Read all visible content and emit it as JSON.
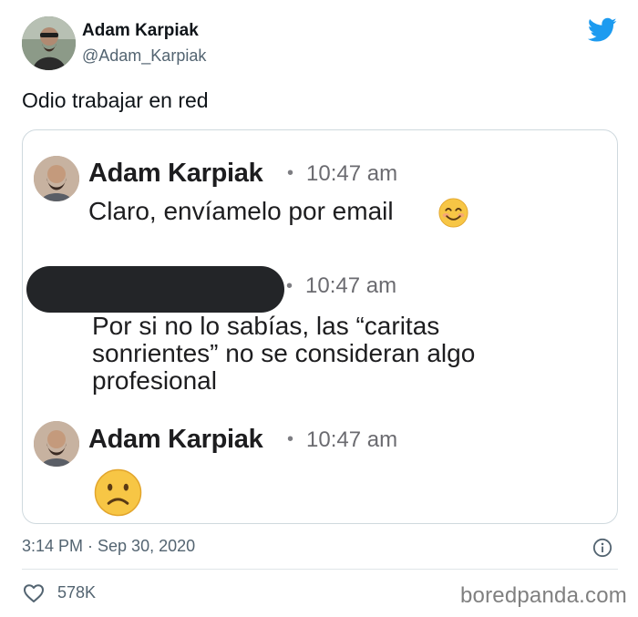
{
  "author": {
    "name": "Adam Karpiak",
    "handle": "@Adam_Karpiak"
  },
  "tweet": {
    "text": "Odio trabajar en red",
    "timestamp": "3:14 PM · Sep 30, 2020",
    "likes": "578K"
  },
  "messages": [
    {
      "sender": "Adam Karpiak",
      "dot": "•",
      "time": "10:47 am",
      "text": "Claro, envíamelo por email",
      "emoji": "smiling-face-icon"
    },
    {
      "sender": "",
      "dot": "•",
      "time": "10:47 am",
      "text_lines": [
        "Por si no lo sabías, las “caritas",
        "sonrientes” no se consideran algo",
        "profesional"
      ]
    },
    {
      "sender": "Adam Karpiak",
      "dot": "•",
      "time": "10:47 am",
      "emoji": "frowning-face-icon"
    }
  ],
  "watermark": "boredpanda.com",
  "colors": {
    "twitter_blue": "#1d9bf0",
    "emoji_yellow": "#f7c645",
    "muted_text": "#536471",
    "redaction": "#232528"
  }
}
